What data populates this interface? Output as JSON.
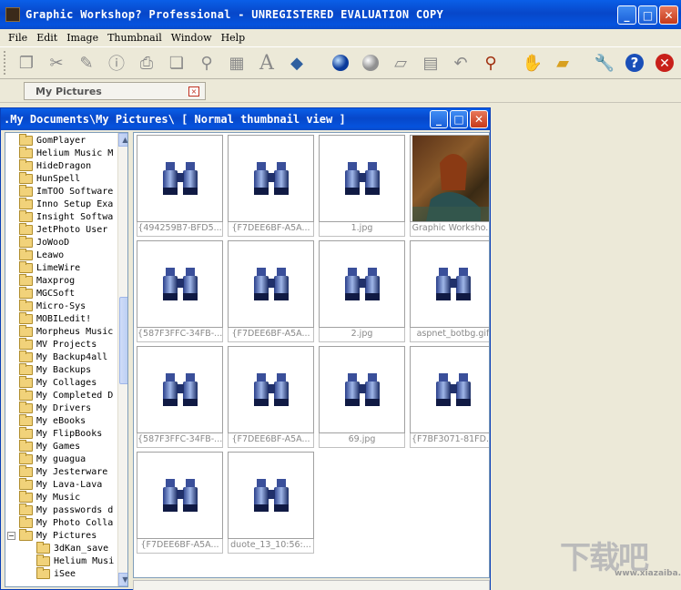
{
  "window": {
    "title": "Graphic Workshop? Professional - UNREGISTERED EVALUATION COPY"
  },
  "menu": [
    "File",
    "Edit",
    "Image",
    "Thumbnail",
    "Window",
    "Help"
  ],
  "toolbar": {
    "icons": [
      "copy-icon",
      "cut-icon",
      "brush-icon",
      "info-icon",
      "print-icon",
      "duplicate-icon",
      "binoculars-icon",
      "select-grid-icon",
      "text-icon",
      "stamp-icon",
      "sphere-icon",
      "circle-icon",
      "eraser-icon",
      "page-icon",
      "undo-icon",
      "zoom-icon",
      "hand-icon",
      "folder-open-icon",
      "wrench-icon",
      "help-icon",
      "close-icon"
    ]
  },
  "doc_tab": {
    "label": "My Pictures",
    "close": "×"
  },
  "child": {
    "title": ".My Documents\\My Pictures\\ [ Normal thumbnail view ]"
  },
  "tree": [
    {
      "name": "GomPlayer"
    },
    {
      "name": "Helium Music M"
    },
    {
      "name": "HideDragon"
    },
    {
      "name": "HunSpell"
    },
    {
      "name": "ImTOO Software"
    },
    {
      "name": "Inno Setup Exa"
    },
    {
      "name": "Insight Softwa"
    },
    {
      "name": "JetPhoto User"
    },
    {
      "name": "JoWooD"
    },
    {
      "name": "Leawo"
    },
    {
      "name": "LimeWire"
    },
    {
      "name": "Maxprog"
    },
    {
      "name": "MGCSoft"
    },
    {
      "name": "Micro-Sys"
    },
    {
      "name": "MOBILedit!"
    },
    {
      "name": "Morpheus Music"
    },
    {
      "name": "MV Projects"
    },
    {
      "name": "My Backup4all"
    },
    {
      "name": "My Backups"
    },
    {
      "name": "My Collages"
    },
    {
      "name": "My Completed D"
    },
    {
      "name": "My Drivers"
    },
    {
      "name": "My eBooks"
    },
    {
      "name": "My FlipBooks"
    },
    {
      "name": "My Games"
    },
    {
      "name": "My guagua"
    },
    {
      "name": "My Jesterware"
    },
    {
      "name": "My Lava-Lava"
    },
    {
      "name": "My Music"
    },
    {
      "name": "My passwords d"
    },
    {
      "name": "My Photo Colla"
    },
    {
      "name": "My Pictures",
      "expanded": true
    },
    {
      "name": "3dKan_save",
      "sub": true
    },
    {
      "name": "Helium Musi",
      "sub": true
    },
    {
      "name": "iSee",
      "sub": true
    }
  ],
  "thumbnails": [
    {
      "caption": "{494259B7-BFD5...",
      "kind": "binoculars"
    },
    {
      "caption": "{F7DEE6BF-A5A...",
      "kind": "binoculars"
    },
    {
      "caption": "1.jpg",
      "kind": "binoculars"
    },
    {
      "caption": "Graphic Worksho...",
      "kind": "painting"
    },
    {
      "caption": "{587F3FFC-34FB-...",
      "kind": "binoculars"
    },
    {
      "caption": "{F7DEE6BF-A5A...",
      "kind": "binoculars"
    },
    {
      "caption": "2.jpg",
      "kind": "binoculars"
    },
    {
      "caption": "aspnet_botbg.gif",
      "kind": "binoculars"
    },
    {
      "caption": "{587F3FFC-34FB-...",
      "kind": "binoculars"
    },
    {
      "caption": "{F7DEE6BF-A5A...",
      "kind": "binoculars"
    },
    {
      "caption": "69.jpg",
      "kind": "binoculars"
    },
    {
      "caption": "{F7BF3071-81FD...",
      "kind": "binoculars"
    },
    {
      "caption": "{F7DEE6BF-A5A...",
      "kind": "binoculars"
    },
    {
      "caption": "duote_13_10:56:...",
      "kind": "binoculars"
    }
  ],
  "watermark": {
    "text": "下载吧",
    "url": "www.xiazaiba.com"
  }
}
